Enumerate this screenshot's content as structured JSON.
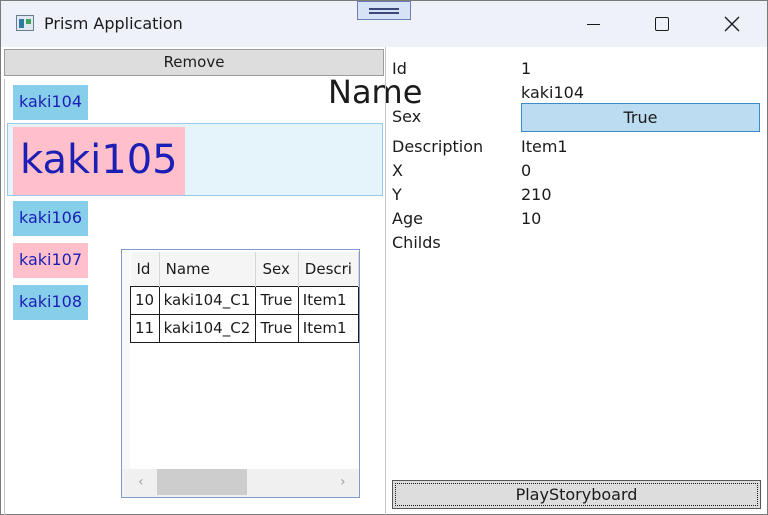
{
  "window": {
    "title": "Prism Application"
  },
  "toolbar": {
    "remove_label": "Remove"
  },
  "list": {
    "overlay_label": "Name",
    "items": [
      {
        "label": "kaki104",
        "color": "#87ceeb"
      },
      {
        "label": "kaki105",
        "color": "#ffc0cb"
      },
      {
        "label": "kaki106",
        "color": "#87ceeb"
      },
      {
        "label": "kaki107",
        "color": "#ffc0cb"
      },
      {
        "label": "kaki108",
        "color": "#87ceeb"
      }
    ]
  },
  "grid": {
    "columns": [
      "Id",
      "Name",
      "Sex",
      "Descri"
    ],
    "rows": [
      [
        "10",
        "kaki104_C1",
        "True",
        "Item1"
      ],
      [
        "11",
        "kaki104_C2",
        "True",
        "Item1"
      ]
    ],
    "scroll_left": "‹",
    "scroll_right": "›"
  },
  "details": {
    "id_label": "Id",
    "id_value": "1",
    "name_value": "kaki104",
    "sex_label": "Sex",
    "sex_value": "True",
    "description_label": "Description",
    "description_value": "Item1",
    "x_label": "X",
    "x_value": "0",
    "y_label": "Y",
    "y_value": "210",
    "age_label": "Age",
    "age_value": "10",
    "childs_label": "Childs"
  },
  "footer": {
    "play_label": "PlayStoryboard"
  },
  "colors": {
    "accent": "#3c8acb",
    "selected_row": "#e5f3fb",
    "item_text": "#1b1fb5"
  }
}
